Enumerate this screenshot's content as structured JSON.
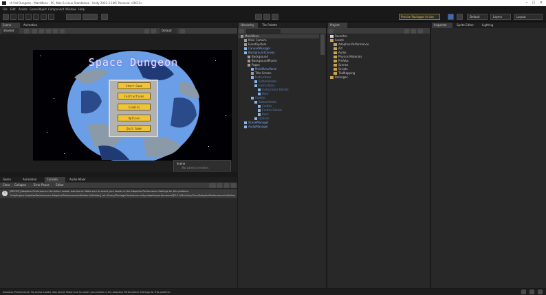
{
  "window": {
    "title": "UI Fall Dungeon - MainMenu - PC, Mac & Linux Standalone - Unity 2022.3.10f1 Personal <DX11>"
  },
  "menu": [
    "File",
    "Edit",
    "Assets",
    "GameObject",
    "Component",
    "Window",
    "Help"
  ],
  "toolbar": {
    "package_manager_label": "Precise Packages In Use",
    "layers_label": "Layers",
    "layout_label": "Layout",
    "dropdown_label": "Default"
  },
  "scene_panel": {
    "tabs": [
      "Scene",
      "Animation"
    ],
    "shading_label": "Shaded",
    "mode_label": "Default"
  },
  "game_view": {
    "title": "Space Dungeon",
    "buttons": [
      "Start Game",
      "Instructions",
      "Credits",
      "Options",
      "Quit Game"
    ]
  },
  "console_panel": {
    "tabs": [
      "Game",
      "Animation",
      "Console",
      "Audio Mixer"
    ],
    "toolbar": {
      "clear_label": "Clear",
      "collapse_label": "Collapse",
      "error_pause_label": "Error Pause",
      "editor_label": "Editor"
    },
    "count": "1",
    "message_line1": "[DEVICE] Adaptive Performance: No Active Loader was found. Make sure to select your loader in the Adaptive Performance Settings for this platform.",
    "message_line2": "UnityEngine.AdaptivePerformance.AdaptivePerformanceInitializer:Initialize() (at Library/PackageCache/com.unity.adaptiveperformance@5.0.0/Runtime/Core/AdaptivePerformanceInitializer.cs:44)"
  },
  "hierarchy_panel": {
    "tabs": [
      "Hierarchy",
      "Tile Palette"
    ],
    "rows": [
      {
        "label": "MainMenu",
        "indent": 0,
        "kind": "scene"
      },
      {
        "label": "Main Camera",
        "indent": 1,
        "kind": "obj"
      },
      {
        "label": "EventSystem",
        "indent": 1,
        "kind": "obj"
      },
      {
        "label": "CanvasManager",
        "indent": 1,
        "kind": "prefab"
      },
      {
        "label": "BackgroundCanvas",
        "indent": 1,
        "kind": "prefab"
      },
      {
        "label": "Background",
        "indent": 2,
        "kind": "obj"
      },
      {
        "label": "BackgroundPlanet",
        "indent": 2,
        "kind": "obj"
      },
      {
        "label": "Pages",
        "indent": 2,
        "kind": "obj"
      },
      {
        "label": "MainMenuPanel",
        "indent": 3,
        "kind": "prefab"
      },
      {
        "label": "Title Screen",
        "indent": 3,
        "kind": "obj"
      },
      {
        "label": "Instructions",
        "indent": 3,
        "kind": "dim"
      },
      {
        "label": "ButtonHolder",
        "indent": 4,
        "kind": "dim"
      },
      {
        "label": "Instructions",
        "indent": 4,
        "kind": "dim"
      },
      {
        "label": "Instructions Details",
        "indent": 5,
        "kind": "dim"
      },
      {
        "label": "Back",
        "indent": 5,
        "kind": "dim"
      },
      {
        "label": "Credits",
        "indent": 3,
        "kind": "dim"
      },
      {
        "label": "ButtonHolder",
        "indent": 4,
        "kind": "dim"
      },
      {
        "label": "Credits",
        "indent": 5,
        "kind": "dim"
      },
      {
        "label": "Credits Details",
        "indent": 5,
        "kind": "dim"
      },
      {
        "label": "Back",
        "indent": 5,
        "kind": "dim"
      },
      {
        "label": "Options",
        "indent": 4,
        "kind": "dim"
      },
      {
        "label": "SceneManager",
        "indent": 1,
        "kind": "prefab"
      },
      {
        "label": "AudioManager",
        "indent": 1,
        "kind": "prefab"
      }
    ]
  },
  "project_panel": {
    "tabs": [
      "Project"
    ],
    "rows": [
      {
        "label": "Favorites",
        "indent": 0,
        "kind": "star"
      },
      {
        "label": "Assets",
        "indent": 0,
        "kind": "folder"
      },
      {
        "label": "Adaptive Performance",
        "indent": 1,
        "kind": "folder"
      },
      {
        "label": "Art",
        "indent": 1,
        "kind": "folder"
      },
      {
        "label": "Audio",
        "indent": 1,
        "kind": "folder"
      },
      {
        "label": "Physics Materials",
        "indent": 1,
        "kind": "folder"
      },
      {
        "label": "Prefabs",
        "indent": 1,
        "kind": "folder"
      },
      {
        "label": "Scenes",
        "indent": 1,
        "kind": "folder"
      },
      {
        "label": "Scripts",
        "indent": 1,
        "kind": "folder"
      },
      {
        "label": "TileMapping",
        "indent": 1,
        "kind": "folder"
      },
      {
        "label": "Packages",
        "indent": 0,
        "kind": "folder"
      }
    ]
  },
  "inspector_panel": {
    "tabs": [
      "Inspector",
      "Sprite Editor",
      "Lighting"
    ]
  },
  "toast": {
    "title": "Scene",
    "text": "No camera renders"
  },
  "status_bar": {
    "message": "Adaptive Performance: No Active Loader was found. Make sure to select your loader in the Adaptive Performance Settings for this platform."
  }
}
